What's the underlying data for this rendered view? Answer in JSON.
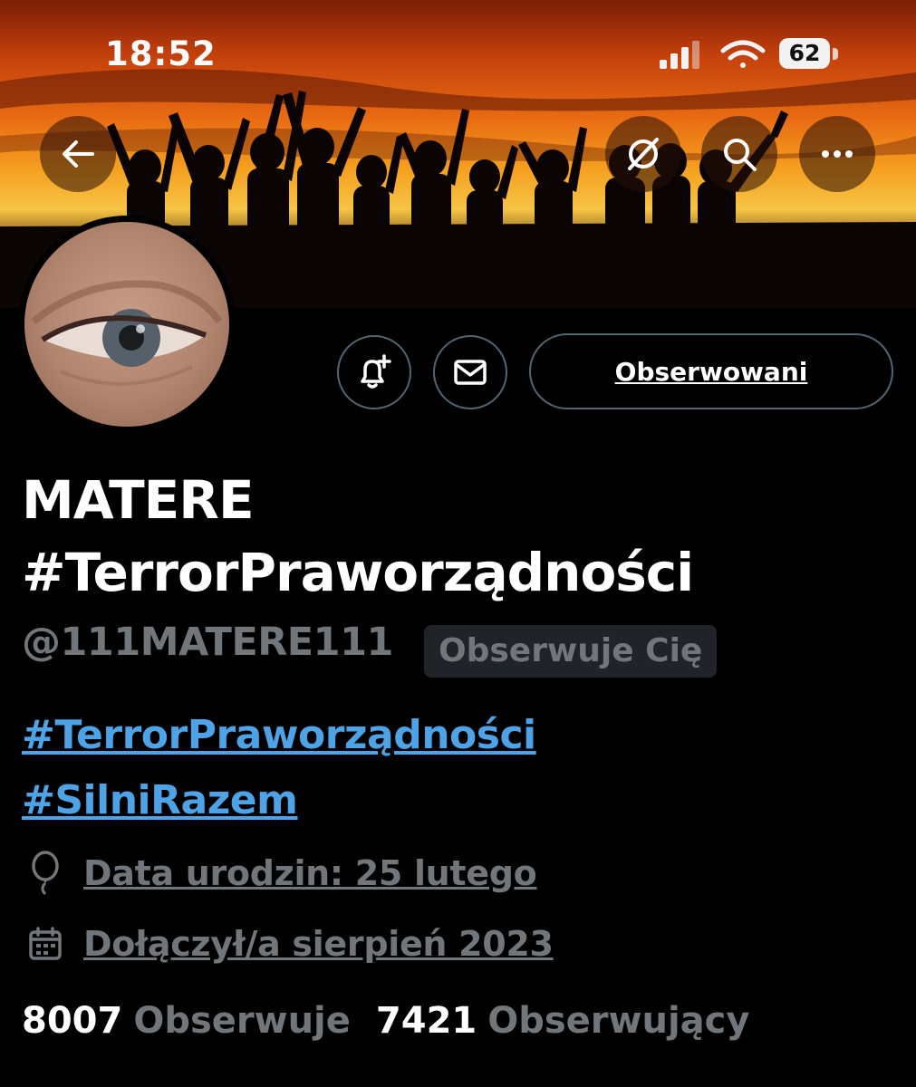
{
  "status_bar": {
    "time": "18:52",
    "battery": "62"
  },
  "header": {
    "buttons": [
      "back",
      "grok",
      "search",
      "more"
    ]
  },
  "profile": {
    "display_name": "MATERE #TerrorPraworządności",
    "handle": "@111MATERE111",
    "follows_you_badge": "Obserwuje Cię",
    "following_button": "Obserwowani",
    "bio_hashtags": [
      "#TerrorPraworządności",
      "#SilniRazem"
    ],
    "birthday": "Data urodzin: 25 lutego",
    "joined": "Dołączył/a sierpień 2023",
    "following_count": "8007",
    "following_label": "Obserwuje",
    "followers_count": "7421",
    "followers_label": "Obserwujący"
  },
  "colors": {
    "background": "#000000",
    "link": "#4ea3e6",
    "muted": "#71767b",
    "border": "#536471"
  },
  "icons": [
    "back-arrow-icon",
    "grok-icon",
    "search-icon",
    "more-dots-icon",
    "bell-plus-icon",
    "mail-icon",
    "balloon-icon",
    "calendar-icon",
    "wifi-icon",
    "signal-icon"
  ]
}
